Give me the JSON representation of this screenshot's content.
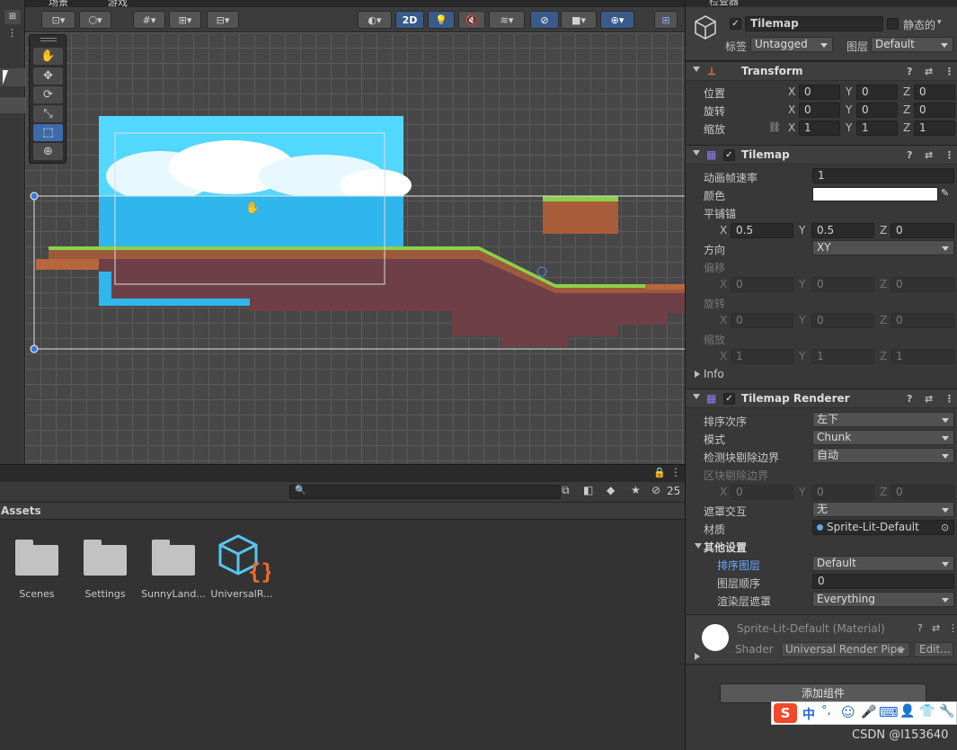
{
  "scene": {
    "tabs": [
      "场景",
      "游戏"
    ],
    "toolbar": {
      "mode_2d": "2D"
    }
  },
  "project": {
    "search_placeholder": "",
    "hidden_count": "25",
    "breadcrumb": "Assets",
    "assets": [
      {
        "label": "Scenes",
        "kind": "folder"
      },
      {
        "label": "Settings",
        "kind": "folder"
      },
      {
        "label": "SunnyLand...",
        "kind": "folder"
      },
      {
        "label": "UniversalR...",
        "kind": "script-asset"
      }
    ]
  },
  "inspector": {
    "title": "检查器",
    "object": {
      "name": "Tilemap",
      "static_label": "静态的",
      "tag_label": "标签",
      "tag_value": "Untagged",
      "layer_label": "图层",
      "layer_value": "Default"
    },
    "transform": {
      "title": "Transform",
      "position_label": "位置",
      "rotation_label": "旋转",
      "scale_label": "缩放",
      "position": {
        "x": "0",
        "y": "0",
        "z": "0"
      },
      "rotation": {
        "x": "0",
        "y": "0",
        "z": "0"
      },
      "scale": {
        "x": "1",
        "y": "1",
        "z": "1"
      }
    },
    "tilemap": {
      "title": "Tilemap",
      "frame_rate_label": "动画帧速率",
      "frame_rate": "1",
      "color_label": "颜色",
      "anchor_label": "平铺锚",
      "anchor": {
        "x": "0.5",
        "y": "0.5",
        "z": "0"
      },
      "orientation_label": "方向",
      "orientation": "XY",
      "offset_label": "偏移",
      "offset": {
        "x": "0",
        "y": "0",
        "z": "0"
      },
      "rotation_label": "旋转",
      "rotation": {
        "x": "0",
        "y": "0",
        "z": "0"
      },
      "scale_label": "缩放",
      "scale": {
        "x": "1",
        "y": "1",
        "z": "1"
      },
      "info_label": "Info"
    },
    "renderer": {
      "title": "Tilemap Renderer",
      "sort_order_label": "排序次序",
      "sort_order": "左下",
      "mode_label": "模式",
      "mode": "Chunk",
      "detect_bounds_label": "检测块剔除边界",
      "detect_bounds": "自动",
      "chunk_bounds_label": "区块剔除边界",
      "chunk_bounds": {
        "x": "0",
        "y": "0",
        "z": "0"
      },
      "mask_label": "遮罩交互",
      "mask": "无",
      "material_label": "材质",
      "material": "Sprite-Lit-Default",
      "other_label": "其他设置",
      "sorting_layer_label": "排序图层",
      "sorting_layer": "Default",
      "order_label": "图层顺序",
      "order": "0",
      "render_mask_label": "渲染层遮罩",
      "render_mask": "Everything"
    },
    "material_section": {
      "name": "Sprite-Lit-Default (Material)",
      "shader_label": "Shader",
      "shader": "Universal Render Pipe",
      "edit": "Edit..."
    },
    "add_component": "添加组件",
    "axis": {
      "x": "X",
      "y": "Y",
      "z": "Z"
    }
  },
  "watermark": "CSDN @l153640",
  "colors": {
    "accent": "#3e6ba8",
    "sky": "#38c8f0",
    "dirt": "#6e3f47"
  }
}
